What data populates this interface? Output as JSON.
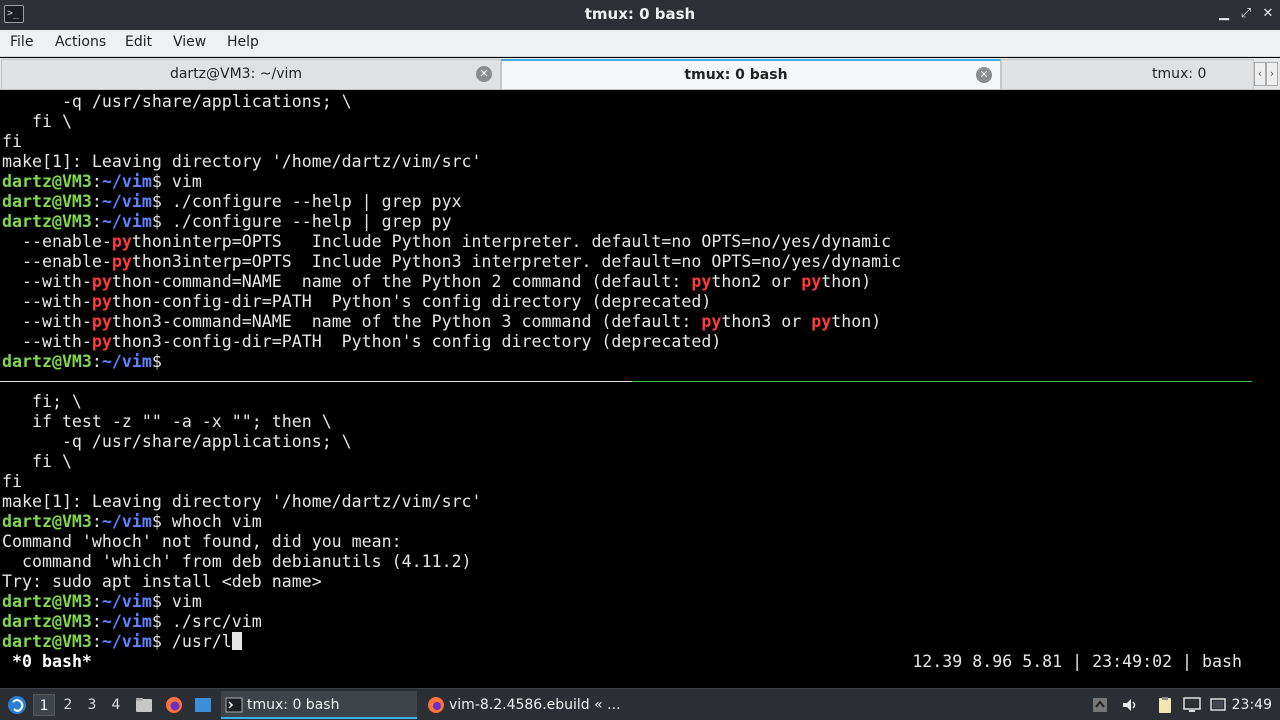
{
  "window": {
    "title": "tmux: 0 bash",
    "app_icon_text": ">_",
    "minimize_glyph": "▁",
    "restore_glyph": "⤢",
    "close_glyph": "✕"
  },
  "menu": [
    "File",
    "Actions",
    "Edit",
    "View",
    "Help"
  ],
  "tabs": [
    {
      "label": "dartz@VM3: ~/vim",
      "close": "✕"
    },
    {
      "label": "tmux: 0 bash",
      "close": "✕"
    },
    {
      "label": "tmux: 0",
      "close": ""
    }
  ],
  "tab_scroll": {
    "left": "‹",
    "right": "›"
  },
  "prompt": {
    "user": "dartz@VM3",
    "sep": ":",
    "path": "~/vim",
    "dollar": "$ "
  },
  "pane_top": [
    {
      "text": "      -q /usr/share/applications; \\"
    },
    {
      "text": "   fi \\"
    },
    {
      "text": "fi"
    },
    {
      "text": "make[1]: Leaving directory '/home/dartz/vim/src'"
    },
    {
      "cmd": "vim"
    },
    {
      "cmd": "./configure --help | grep pyx"
    },
    {
      "cmd": "./configure --help | grep py"
    },
    {
      "segments": [
        "  --enable-",
        "py",
        "thoninterp=OPTS   Include Python interpreter. default=no OPTS=no/yes/dynamic"
      ]
    },
    {
      "segments": [
        "  --enable-",
        "py",
        "thon3interp=OPTS  Include Python3 interpreter. default=no OPTS=no/yes/dynamic"
      ]
    },
    {
      "segments": [
        "  --with-",
        "py",
        "thon-command=NAME  name of the Python 2 command (default: ",
        "py",
        "thon2 or ",
        "py",
        "thon)"
      ]
    },
    {
      "segments": [
        "  --with-",
        "py",
        "thon-config-dir=PATH  Python's config directory (deprecated)"
      ]
    },
    {
      "segments": [
        "  --with-",
        "py",
        "thon3-command=NAME  name of the Python 3 command (default: ",
        "py",
        "thon3 or ",
        "py",
        "thon)"
      ]
    },
    {
      "segments": [
        "  --with-",
        "py",
        "thon3-config-dir=PATH  Python's config directory (deprecated)"
      ]
    },
    {
      "cmd": ""
    }
  ],
  "pane_bottom": [
    {
      "text": "   fi; \\"
    },
    {
      "text": "   if test -z \"\" -a -x \"\"; then \\"
    },
    {
      "text": "      -q /usr/share/applications; \\"
    },
    {
      "text": "   fi \\"
    },
    {
      "text": "fi"
    },
    {
      "text": "make[1]: Leaving directory '/home/dartz/vim/src'"
    },
    {
      "cmd": "whoch vim"
    },
    {
      "text": "Command 'whoch' not found, did you mean:"
    },
    {
      "text": "  command 'which' from deb debianutils (4.11.2)"
    },
    {
      "text": "Try: sudo apt install <deb name>"
    },
    {
      "cmd": "vim"
    },
    {
      "cmd": "./src/vim"
    },
    {
      "cmd": "/usr/l",
      "cursor": true
    }
  ],
  "tmux_status": {
    "left": "*0 bash*",
    "right": "12.39 8.96 5.81 | 23:49:02 | bash"
  },
  "taskbar": {
    "workspaces": [
      "1",
      "2",
      "3",
      "4"
    ],
    "active_workspace": "1",
    "tasks": [
      {
        "label": "tmux: 0 bash",
        "active": true
      },
      {
        "label": "vim-8.2.4586.ebuild « ...",
        "active": false
      }
    ],
    "clock": "23:49"
  },
  "colors": {
    "user": "#7fd850",
    "path": "#5e83ff",
    "match": "#ff3b3b",
    "accent": "#3daee9",
    "pane_active_border": "#3fbf3f"
  }
}
